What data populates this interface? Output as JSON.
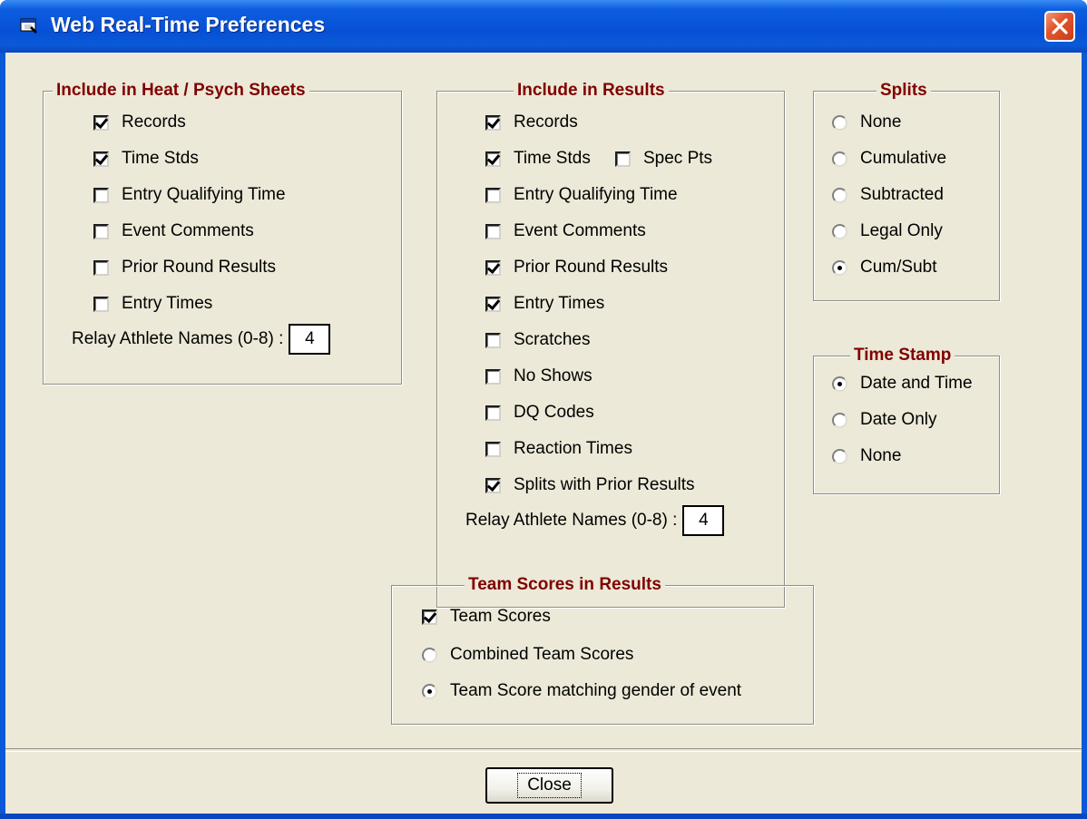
{
  "window": {
    "title": "Web Real-Time Preferences",
    "titlebar_color": "#0a5ad8",
    "close_icon": "close-x-icon"
  },
  "heat_psych": {
    "legend": "Include in Heat / Psych Sheets",
    "items": [
      {
        "label": "Records",
        "checked": true
      },
      {
        "label": "Time Stds",
        "checked": true
      },
      {
        "label": "Entry Qualifying Time",
        "checked": false
      },
      {
        "label": "Event Comments",
        "checked": false
      },
      {
        "label": "Prior Round Results",
        "checked": false
      },
      {
        "label": "Entry Times",
        "checked": false
      }
    ],
    "relay_label": "Relay Athlete Names (0-8) :",
    "relay_value": "4"
  },
  "results": {
    "legend": "Include in Results",
    "items": [
      {
        "label": "Records",
        "checked": true
      },
      {
        "label": "Time Stds",
        "checked": true
      },
      {
        "label": "Spec Pts",
        "checked": false
      },
      {
        "label": "Entry Qualifying Time",
        "checked": false
      },
      {
        "label": "Event Comments",
        "checked": false
      },
      {
        "label": "Prior Round Results",
        "checked": true
      },
      {
        "label": "Entry Times",
        "checked": true
      },
      {
        "label": "Scratches",
        "checked": false
      },
      {
        "label": "No Shows",
        "checked": false
      },
      {
        "label": "DQ Codes",
        "checked": false
      },
      {
        "label": "Reaction Times",
        "checked": false
      },
      {
        "label": "Splits with Prior Results",
        "checked": true
      }
    ],
    "relay_label": "Relay Athlete Names (0-8) :",
    "relay_value": "4"
  },
  "splits": {
    "legend": "Splits",
    "options": [
      "None",
      "Cumulative",
      "Subtracted",
      "Legal Only",
      "Cum/Subt"
    ],
    "selected": "Cum/Subt"
  },
  "time_stamp": {
    "legend": "Time Stamp",
    "options": [
      "Date and Time",
      "Date Only",
      "None"
    ],
    "selected": "Date and Time"
  },
  "team_scores": {
    "legend": "Team Scores in Results",
    "checkbox_label": "Team Scores",
    "checkbox_checked": true,
    "options": [
      "Combined Team Scores",
      "Team Score matching gender of event"
    ],
    "selected": "Team Score matching gender of event"
  },
  "footer": {
    "close_label": "Close"
  }
}
